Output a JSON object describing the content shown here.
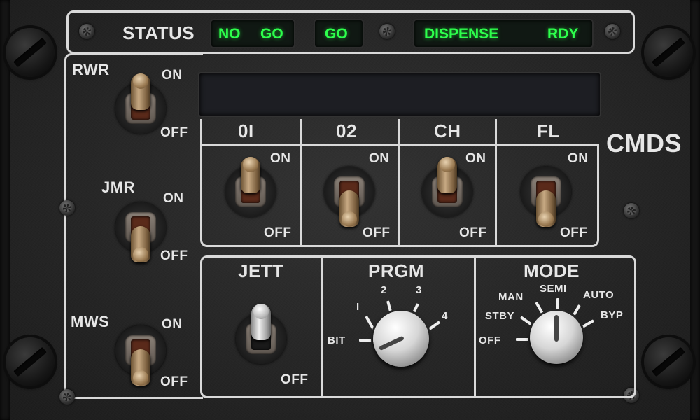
{
  "status_bar": {
    "label": "STATUS",
    "indicators": [
      {
        "left": "NO",
        "right": "GO"
      },
      {
        "left": "GO"
      },
      {
        "left": "DISPENSE",
        "right": "RDY"
      }
    ],
    "lcd_color": "#2dff4c"
  },
  "title": "CMDS",
  "left_switches": [
    {
      "name": "RWR",
      "on": "ON",
      "off": "OFF",
      "position": "on"
    },
    {
      "name": "JMR",
      "on": "ON",
      "off": "OFF",
      "position": "off"
    },
    {
      "name": "MWS",
      "on": "ON",
      "off": "OFF",
      "position": "off"
    }
  ],
  "dispenser_switches": [
    {
      "name": "0I",
      "on": "ON",
      "off": "OFF",
      "position": "on"
    },
    {
      "name": "02",
      "on": "ON",
      "off": "OFF",
      "position": "off"
    },
    {
      "name": "CH",
      "on": "ON",
      "off": "OFF",
      "position": "on"
    },
    {
      "name": "FL",
      "on": "ON",
      "off": "OFF",
      "position": "off"
    }
  ],
  "jett": {
    "label": "JETT",
    "off": "OFF",
    "position": "up"
  },
  "prgm": {
    "label": "PRGM",
    "positions": [
      "BIT",
      "I",
      "2",
      "3",
      "4"
    ],
    "selected": "BIT"
  },
  "mode": {
    "label": "MODE",
    "positions": [
      "OFF",
      "STBY",
      "MAN",
      "SEMI",
      "AUTO",
      "BYP"
    ],
    "selected": "SEMI"
  },
  "frame_color": "#d9d9d9"
}
